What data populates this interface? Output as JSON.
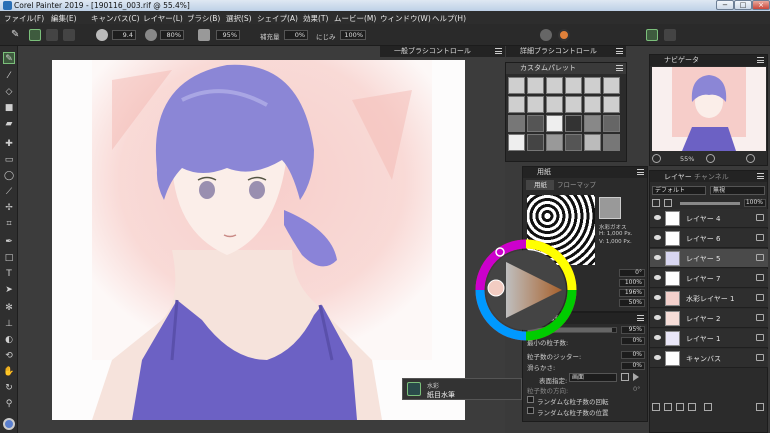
{
  "window": {
    "title": "Corel Painter 2019 - [190116_003.rif @ 55.4%]",
    "minimize": "−",
    "maximize": "□",
    "close": "×"
  },
  "menu": [
    "ファイル(F)",
    "編集(E)",
    "キャンバス(C)",
    "レイヤー(L)",
    "ブラシ(B)",
    "選択(S)",
    "シェイプ(A)",
    "効果(T)",
    "ムービー(M)",
    "ウィンドウ(W)",
    "ヘルプ(H)"
  ],
  "propbar": {
    "size": "9.4",
    "opacity": "80%",
    "grain": "95%",
    "resat_label": "補充量",
    "resat": "0%",
    "bleed_label": "にじみ",
    "bleed": "100%"
  },
  "panels": {
    "general_brush": "一般ブラシコントロール",
    "detail_brush": "詳細ブラシコントロール",
    "custom_palette": "カスタムパレット",
    "paper_group": "用紙",
    "paper_tab": "用紙",
    "flowmap_tab": "フローマップ",
    "paper_overlay": [
      "水彩ガオス",
      "H: 1,000 Px.",
      "V: 1,000 Px."
    ],
    "paper_vals": [
      "0°",
      "100%",
      "196%",
      "50%"
    ],
    "particle_title": "粒子数",
    "particle_rows": [
      {
        "label": "",
        "value": "95%"
      },
      {
        "label": "最小の粒子数:",
        "value": "0%"
      },
      {
        "label": "粒子数のジッター:",
        "value": "0%"
      },
      {
        "label": "滑らかさ:",
        "value": "0%"
      }
    ],
    "display_label": "表面指定:",
    "display_value": "画面",
    "particle_direction": "粒子数の方向:",
    "particle_direction_value": "0°",
    "random_rotation": "ランダムな粒子数の回転",
    "random_position": "ランダムな粒子数の位置",
    "navigator": "ナビゲータ",
    "nav_zoom": "55%",
    "layers_tab": "レイヤー",
    "channels_tab": "チャンネル",
    "composite_method": "デフォルト",
    "composite_depth": "無視",
    "layer_opacity": "100%",
    "layers": [
      "レイヤー 4",
      "レイヤー 6",
      "レイヤー 5",
      "レイヤー 7",
      "水彩レイヤー 1",
      "レイヤー 2",
      "レイヤー 1",
      "キャンバス"
    ]
  },
  "brush_tooltip": {
    "category": "水彩",
    "variant": "紙目水筆"
  },
  "colors": {
    "bg": "#3a3a3a",
    "panel": "#2b2b2b",
    "selected_layer": "#4a4a4a",
    "hair": "#8b86d6",
    "color_main": "#e0813a"
  }
}
